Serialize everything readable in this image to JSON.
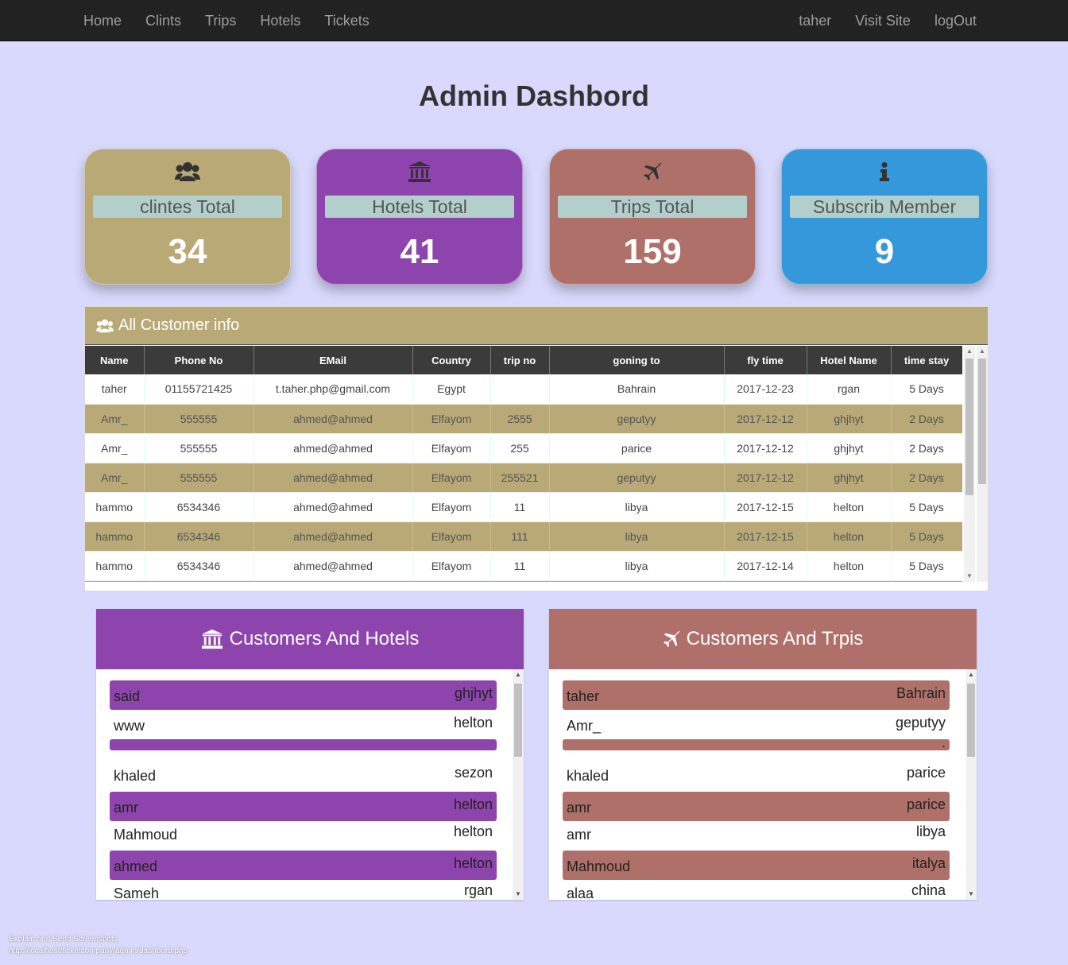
{
  "nav": {
    "left": [
      "Home",
      "Clints",
      "Trips",
      "Hotels",
      "Tickets"
    ],
    "right": [
      "taher",
      "Visit Site",
      "logOut"
    ]
  },
  "title": "Admin Dashbord",
  "cards": [
    {
      "label": "clintes Total",
      "value": "34",
      "icon": "users-icon",
      "color": "#b8a977"
    },
    {
      "label": "Hotels Total",
      "value": "41",
      "icon": "bank-icon",
      "color": "#8e44ad"
    },
    {
      "label": "Trips Total",
      "value": "159",
      "icon": "plane-icon",
      "color": "#b0706a"
    },
    {
      "label": "Subscrib Member",
      "value": "9",
      "icon": "info-icon",
      "color": "#3498db"
    }
  ],
  "customers": {
    "heading": "All Customer info",
    "columns": [
      "Name",
      "Phone No",
      "EMail",
      "Country",
      "trip no",
      "goning to",
      "fly time",
      "Hotel Name",
      "time stay"
    ],
    "rows": [
      [
        "taher",
        "01155721425",
        "t.taher.php@gmail.com",
        "Egypt",
        "",
        "Bahrain",
        "2017-12-23",
        "rgan",
        "5 Days"
      ],
      [
        "Amr_",
        "555555",
        "ahmed@ahmed",
        "Elfayom",
        "2555",
        "geputyy",
        "2017-12-12",
        "ghjhyt",
        "2 Days"
      ],
      [
        "Amr_",
        "555555",
        "ahmed@ahmed",
        "Elfayom",
        "255",
        "parice",
        "2017-12-12",
        "ghjhyt",
        "2 Days"
      ],
      [
        "Amr_",
        "555555",
        "ahmed@ahmed",
        "Elfayom",
        "255521",
        "geputyy",
        "2017-12-12",
        "ghjhyt",
        "2 Days"
      ],
      [
        "hammo",
        "6534346",
        "ahmed@ahmed",
        "Elfayom",
        "11",
        "libya",
        "2017-12-15",
        "helton",
        "5 Days"
      ],
      [
        "hammo",
        "6534346",
        "ahmed@ahmed",
        "Elfayom",
        "111",
        "libya",
        "2017-12-15",
        "helton",
        "5 Days"
      ],
      [
        "hammo",
        "6534346",
        "ahmed@ahmed",
        "Elfayom",
        "11",
        "libya",
        "2017-12-14",
        "helton",
        "5 Days"
      ],
      [
        "",
        "",
        "",
        "",
        "",
        "",
        "",
        "",
        ""
      ]
    ]
  },
  "hotels_panel": {
    "heading": "Customers And Hotels",
    "color": "#8e44ad",
    "items": [
      {
        "name": "said",
        "value": "ghjhyt"
      },
      {
        "name": "www",
        "value": "helton"
      },
      {
        "name": "",
        "value": ""
      },
      {
        "name": "khaled",
        "value": "sezon"
      },
      {
        "name": "amr",
        "value": "helton"
      },
      {
        "name": "Mahmoud",
        "value": "helton"
      },
      {
        "name": "ahmed",
        "value": "helton"
      },
      {
        "name": "Sameh",
        "value": "rgan"
      }
    ]
  },
  "trips_panel": {
    "heading": "Customers And Trpis",
    "color": "#b0706a",
    "items": [
      {
        "name": "taher",
        "value": "Bahrain"
      },
      {
        "name": "Amr_",
        "value": "geputyy"
      },
      {
        "name": "",
        "value": "."
      },
      {
        "name": "khaled",
        "value": "parice"
      },
      {
        "name": "amr",
        "value": "parice"
      },
      {
        "name": "amr",
        "value": "libya"
      },
      {
        "name": "Mahmoud",
        "value": "italya"
      },
      {
        "name": "alaa",
        "value": "china"
      }
    ]
  },
  "status": {
    "line1": "Explain and Send Screenshots",
    "line2": "http://localhost/ticketcompany/admin/dashbord.php"
  }
}
